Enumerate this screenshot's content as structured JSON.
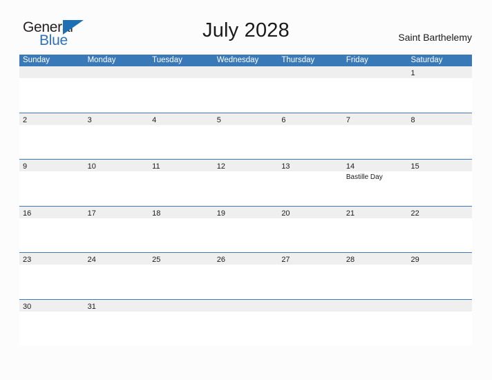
{
  "brand": {
    "name_part1": "General",
    "name_part2": "Blue",
    "color_dark": "#231f20",
    "color_blue": "#2d72b8"
  },
  "header": {
    "title": "July 2028",
    "location": "Saint Barthelemy"
  },
  "theme": {
    "header_blue": "#3a79b8",
    "band_gray": "#efefef",
    "page_background": "#fcfcfc",
    "text_color": "#1a1a1a"
  },
  "calendar": {
    "month": "July",
    "year": "2028",
    "weekday_headers": [
      "Sunday",
      "Monday",
      "Tuesday",
      "Wednesday",
      "Thursday",
      "Friday",
      "Saturday"
    ],
    "weeks": [
      {
        "days": [
          {
            "num": "",
            "event": ""
          },
          {
            "num": "",
            "event": ""
          },
          {
            "num": "",
            "event": ""
          },
          {
            "num": "",
            "event": ""
          },
          {
            "num": "",
            "event": ""
          },
          {
            "num": "",
            "event": ""
          },
          {
            "num": "1",
            "event": ""
          }
        ]
      },
      {
        "days": [
          {
            "num": "2",
            "event": ""
          },
          {
            "num": "3",
            "event": ""
          },
          {
            "num": "4",
            "event": ""
          },
          {
            "num": "5",
            "event": ""
          },
          {
            "num": "6",
            "event": ""
          },
          {
            "num": "7",
            "event": ""
          },
          {
            "num": "8",
            "event": ""
          }
        ]
      },
      {
        "days": [
          {
            "num": "9",
            "event": ""
          },
          {
            "num": "10",
            "event": ""
          },
          {
            "num": "11",
            "event": ""
          },
          {
            "num": "12",
            "event": ""
          },
          {
            "num": "13",
            "event": ""
          },
          {
            "num": "14",
            "event": "Bastille Day"
          },
          {
            "num": "15",
            "event": ""
          }
        ]
      },
      {
        "days": [
          {
            "num": "16",
            "event": ""
          },
          {
            "num": "17",
            "event": ""
          },
          {
            "num": "18",
            "event": ""
          },
          {
            "num": "19",
            "event": ""
          },
          {
            "num": "20",
            "event": ""
          },
          {
            "num": "21",
            "event": ""
          },
          {
            "num": "22",
            "event": ""
          }
        ]
      },
      {
        "days": [
          {
            "num": "23",
            "event": ""
          },
          {
            "num": "24",
            "event": ""
          },
          {
            "num": "25",
            "event": ""
          },
          {
            "num": "26",
            "event": ""
          },
          {
            "num": "27",
            "event": ""
          },
          {
            "num": "28",
            "event": ""
          },
          {
            "num": "29",
            "event": ""
          }
        ]
      },
      {
        "days": [
          {
            "num": "30",
            "event": ""
          },
          {
            "num": "31",
            "event": ""
          },
          {
            "num": "",
            "event": ""
          },
          {
            "num": "",
            "event": ""
          },
          {
            "num": "",
            "event": ""
          },
          {
            "num": "",
            "event": ""
          },
          {
            "num": "",
            "event": ""
          }
        ]
      }
    ]
  }
}
